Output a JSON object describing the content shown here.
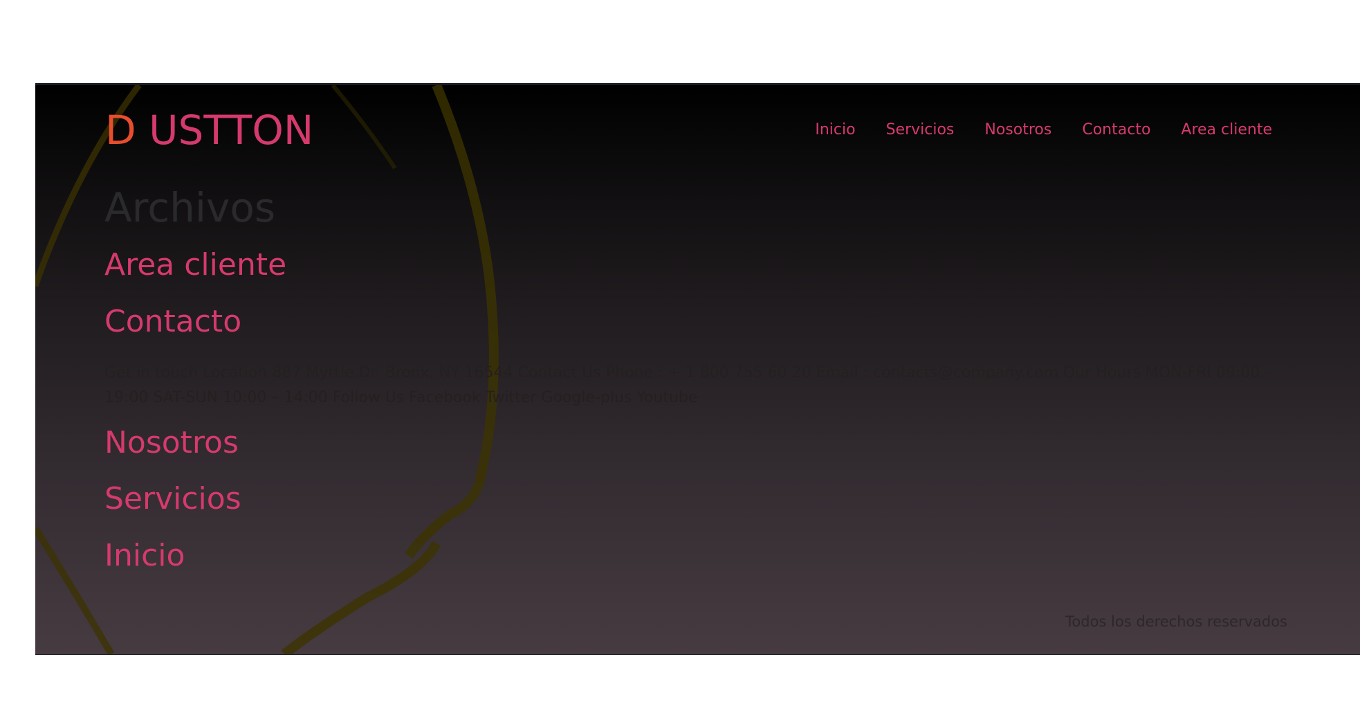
{
  "site": {
    "logo": "DUSTTON",
    "accent_color": "#d63a6d",
    "logo_first_letter_color": "#e84d2e"
  },
  "nav": {
    "items": [
      {
        "label": "Inicio"
      },
      {
        "label": "Servicios"
      },
      {
        "label": "Nosotros"
      },
      {
        "label": "Contacto"
      },
      {
        "label": "Area cliente"
      }
    ]
  },
  "main": {
    "heading": "Archivos",
    "entries": [
      {
        "title": "Area cliente"
      },
      {
        "title": "Contacto",
        "excerpt": "Get in touch Location 887 Myrtle Dr. Bronx, NY 16544 Contact Us Phone : + 1 800 755 60 20 Email : contacts@company.com Our Hours MON-FRI 09:00 – 19:00 SAT-SUN 10:00 – 14:00 Follow Us Facebook Twitter Google-plus Youtube"
      },
      {
        "title": "Nosotros"
      },
      {
        "title": "Servicios"
      },
      {
        "title": "Inicio"
      }
    ]
  },
  "footer": {
    "copyright": "Todos los derechos reservados"
  }
}
